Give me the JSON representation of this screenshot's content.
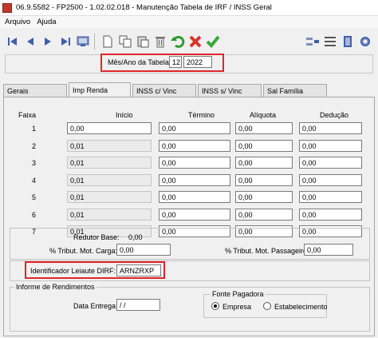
{
  "window": {
    "title": "06.9.5582 - FP2500 - 1.02.02.018 - Manutenção Tabela de IRF / INSS Geral"
  },
  "menu": {
    "items": [
      "Arquivo",
      "Ajuda"
    ]
  },
  "toolbar": {
    "icons": [
      "first-record",
      "prev-record",
      "next-record",
      "last-record",
      "preview",
      "new",
      "copy",
      "paste",
      "trash",
      "undo",
      "cancel",
      "confirm",
      "flow",
      "list",
      "exit",
      "settings"
    ],
    "colors": {
      "nav": "#3f5fa8",
      "undo": "#2e9c2e",
      "cancel": "#d9322b",
      "confirm": "#3aa63a"
    }
  },
  "header": {
    "label": "Mês/Ano da Tabela:",
    "month": "12",
    "year": "2022"
  },
  "tabs": [
    {
      "label": "Gerais"
    },
    {
      "label": "Imp Renda"
    },
    {
      "label": "INSS c/ Vinc"
    },
    {
      "label": "INSS s/ Vinc"
    },
    {
      "label": "Sal Família"
    }
  ],
  "grid": {
    "headers": {
      "faixa": "Faixa",
      "inicio": "Início",
      "termino": "Término",
      "aliquota": "Alíquota",
      "deducao": "Dedução"
    },
    "rows": [
      {
        "faixa": "1",
        "inicio": "0,00",
        "termino": "0,00",
        "aliquota": "0,00",
        "deducao": "0,00"
      },
      {
        "faixa": "2",
        "inicio": "0,01",
        "termino": "0,00",
        "aliquota": "0,00",
        "deducao": "0,00"
      },
      {
        "faixa": "3",
        "inicio": "0,01",
        "termino": "0,00",
        "aliquota": "0,00",
        "deducao": "0,00"
      },
      {
        "faixa": "4",
        "inicio": "0,01",
        "termino": "0,00",
        "aliquota": "0,00",
        "deducao": "0,00"
      },
      {
        "faixa": "5",
        "inicio": "0,01",
        "termino": "0,00",
        "aliquota": "0,00",
        "deducao": "0,00"
      },
      {
        "faixa": "6",
        "inicio": "0,01",
        "termino": "0,00",
        "aliquota": "0,00",
        "deducao": "0,00"
      },
      {
        "faixa": "7",
        "inicio": "0,01",
        "termino": "0,00",
        "aliquota": "0,00",
        "deducao": "0,00"
      }
    ]
  },
  "fields": {
    "redutor_label": "Redutor Base:",
    "redutor_value": "0,00",
    "carga_label": "% Tribut. Mot. Carga:",
    "carga_value": "0,00",
    "passageiro_label": "% Tribut. Mot. Passageiro:",
    "passageiro_value": "0,00",
    "dirf_label": "Identificador Leiaute DIRF:",
    "dirf_value": "ARNZRXP"
  },
  "informe": {
    "group_label": "Informe de Rendimentos",
    "data_label": "Data Entrega:",
    "data_value": "/ /",
    "fonte_label": "Fonte Pagadora",
    "empresa_label": "Empresa",
    "estab_label": "Estabelecimento"
  },
  "highlight_color": "#e0252b"
}
